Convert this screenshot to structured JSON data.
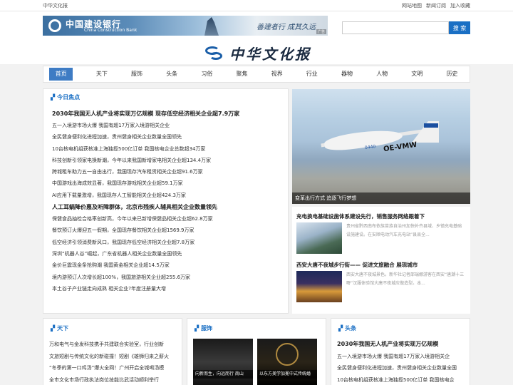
{
  "topbar": {
    "site_name": "中华文化报",
    "links": [
      "网站地图",
      "新闻订阅",
      "加入收藏"
    ]
  },
  "banner": {
    "bank_cn": "中国建设银行",
    "bank_en": "China Construction Bank",
    "slogan": "善建者行 成其久远",
    "ad_label": "广告"
  },
  "search": {
    "placeholder": "",
    "button": "搜 索"
  },
  "brand": {
    "name": "中华文化报"
  },
  "nav": {
    "items": [
      "首页",
      "天下",
      "服饰",
      "头条",
      "习俗",
      "聚焦",
      "视界",
      "行业",
      "器物",
      "人物",
      "文明",
      "历史"
    ],
    "active": 0
  },
  "focus": {
    "title": "今日焦点",
    "rows": [
      {
        "text": "2030年我国无人机产业将实现万亿规模 现存低空经济相关企业超7.9万家",
        "bold": true
      },
      {
        "text": "五一入境游市场火爆 我国有超17万家入境游相关企业",
        "bold": false
      },
      {
        "text": "全民健身便利化进程加速，贵州健身相关企业数量全国领先",
        "bold": false
      },
      {
        "text": "10台核电机组获核准上海独揽500亿订单 我国核电企业总数超34万家",
        "bold": false
      },
      {
        "text": "科技创新引领家电换新潮，今年以来我国新增家电相关企业超134.4万家",
        "bold": false
      },
      {
        "text": "跨城租车助力五一自由出行，我国现存汽车租赁相关企业超91.6万家",
        "bold": false
      },
      {
        "text": "中国游戏出海成效显著，我国现存游戏相关企业超59.1万家",
        "bold": false
      },
      {
        "text": "AI应用下载量激增，我国现存人工智能相关企业超424.3万家",
        "bold": false
      },
      {
        "text": "人工耳蜗降价惠及听障群体，北京市残疾人辅具相关企业数量领先",
        "bold": true
      },
      {
        "text": "保健食品抽检合格率创新高，今年以来已新增保健品相关企业超62.8万家",
        "bold": false
      },
      {
        "text": "餐饮预订火爆迎五一假期，全国现存餐饮相关企业超1569.9万家",
        "bold": false
      },
      {
        "text": "低空经济引领消费新风口，我国现存低空经济相关企业超7.8万家",
        "bold": false
      },
      {
        "text": "深圳“机器人谷”崛起，广东省机器人相关企业数量全国领先",
        "bold": false
      },
      {
        "text": "金价巨震现金条抢购潮 我国黄金相关企业超14.5万家",
        "bold": false
      },
      {
        "text": "境内游预订人次增长超100%，我国旅游相关企业超255.6万家",
        "bold": false
      },
      {
        "text": "本土谷子产业链走向成熟 相关企业?年度注册量大增",
        "bold": false
      }
    ]
  },
  "photo": {
    "caption": "变革出行方式 追逐飞行梦想",
    "registration": "OE-VMW",
    "number": "0440"
  },
  "side_news": [
    {
      "title": "充电换电基础设施体系建设先行，销售服务网络跟着下",
      "desc": "贵州省黔西南布依族苗族自治州加快补齐县域、乡镇充电基础设施建设。在安顺电动汽车充电站”县县全..."
    },
    {
      "title": "西安大唐不夜城步行街—— 促进文旅融合 展现城市",
      "desc": "西安大唐不夜城景色。新华社记者邵瑞娜游客在西安“唐潮十三嘢”汉服体验馆大唐不夜城应做造型。本..."
    }
  ],
  "bottom": {
    "tianxia": {
      "title": "天下",
      "lines": [
        "万和电气与金发科技携手共建联合实验室，行业创新",
        "文旅短剧与传统文化的新碰撞！短剧《雄狮归来之薪火",
        "“冬季的第一口鸡汤”爆火全网！广州开启全城喝汤模",
        "全市文化市场行政执法岗位技能比武活动顺利举行"
      ]
    },
    "fushi": {
      "title": "服饰",
      "captions": [
        "向新而生，向远而行 南山",
        "以东方美学加冕中式传统婚"
      ]
    },
    "toutiao": {
      "title": "头条",
      "lines": [
        {
          "text": "2030年我国无人机产业将实现万亿规模",
          "bold": true
        },
        {
          "text": "五一入境游市场火爆 我国有超17万家入境游相关企",
          "bold": false
        },
        {
          "text": "全民健身便利化进程加速，贵州健身相关企业数量全国",
          "bold": false
        },
        {
          "text": "10台核电机组获核准上海独揽500亿订单 我国核电企",
          "bold": false
        }
      ]
    }
  }
}
